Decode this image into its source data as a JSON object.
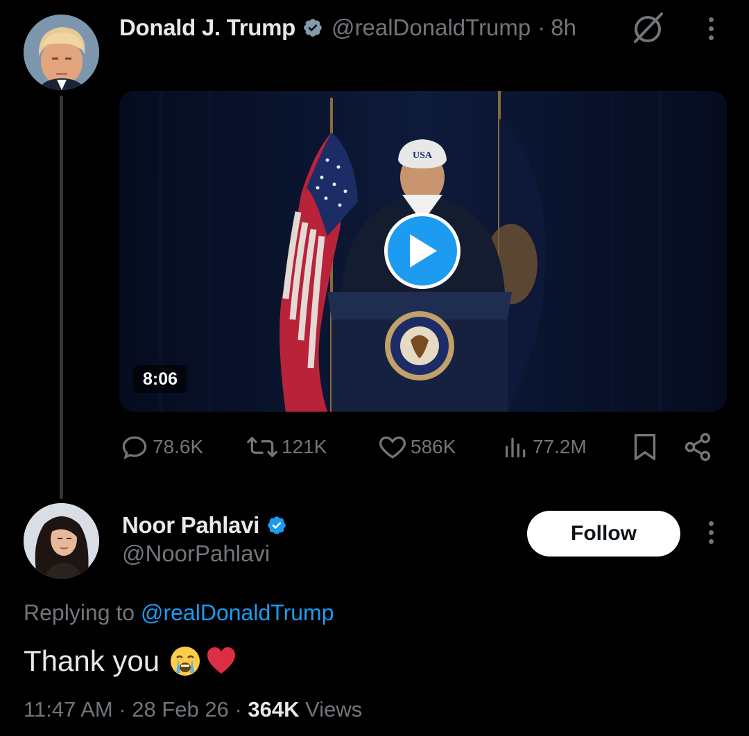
{
  "tweet1": {
    "author_name": "Donald J. Trump",
    "author_handle": "@realDonaldTrump",
    "separator": "·",
    "time": "8h",
    "media": {
      "duration": "8:06",
      "hat_text": "USA",
      "seal_text": "SEAL OF THE PRESIDENT OF THE UNITED STATES"
    },
    "actions": {
      "replies": "78.6K",
      "reposts": "121K",
      "likes": "586K",
      "views": "77.2M"
    }
  },
  "tweet2": {
    "author_name": "Noor Pahlavi",
    "author_handle": "@NoorPahlavi",
    "follow_label": "Follow",
    "replying_prefix": "Replying to",
    "replying_handle": "@realDonaldTrump",
    "text": "Thank you",
    "emojis": [
      "loudly-crying-face",
      "red-heart"
    ],
    "timestamp": "11:47 AM · 28 Feb 26 ·",
    "views_count": "364K",
    "views_label": "Views"
  },
  "colors": {
    "background": "#000000",
    "primary_text": "#e7e9ea",
    "secondary_text": "#71767b",
    "accent": "#1d9bf0",
    "heart": "#f91880"
  }
}
